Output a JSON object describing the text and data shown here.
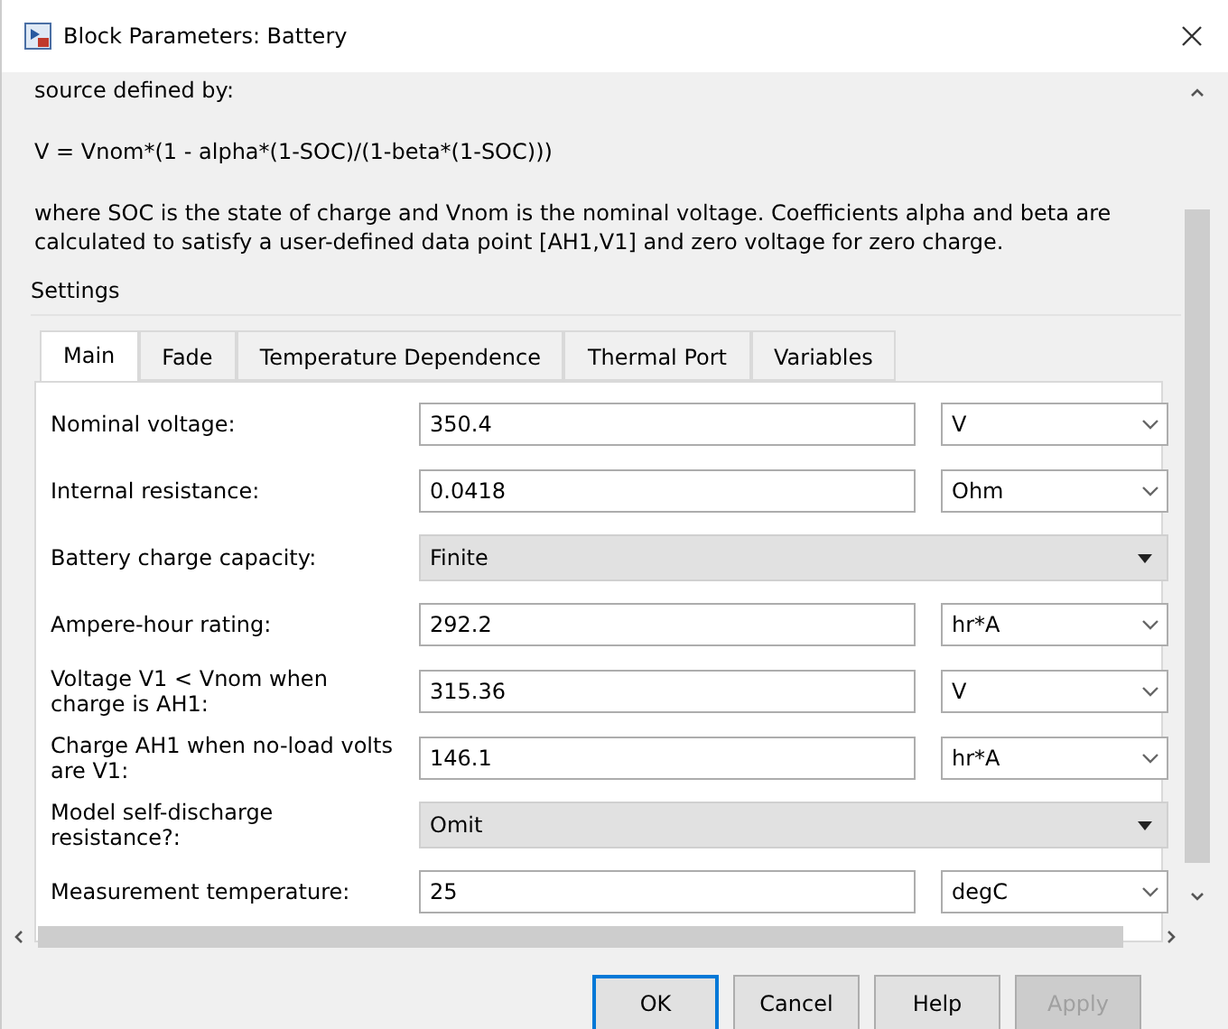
{
  "window": {
    "title": "Block Parameters: Battery"
  },
  "description": [
    "source defined by:",
    "V = Vnom*(1 - alpha*(1-SOC)/(1-beta*(1-SOC)))",
    "where SOC is the state of charge and Vnom is the nominal voltage. Coefficients alpha and beta are calculated to satisfy a user-defined data point [AH1,V1] and zero voltage for zero charge."
  ],
  "settings": {
    "title": "Settings",
    "tabs": [
      {
        "label": "Main",
        "selected": true
      },
      {
        "label": "Fade",
        "selected": false
      },
      {
        "label": "Temperature Dependence",
        "selected": false
      },
      {
        "label": "Thermal Port",
        "selected": false
      },
      {
        "label": "Variables",
        "selected": false
      }
    ],
    "rows": [
      {
        "kind": "value",
        "label": "Nominal voltage:",
        "value": "350.4",
        "unit": "V"
      },
      {
        "kind": "value",
        "label": "Internal resistance:",
        "value": "0.0418",
        "unit": "Ohm"
      },
      {
        "kind": "choice",
        "label": "Battery charge capacity:",
        "value": "Finite"
      },
      {
        "kind": "value",
        "label": "Ampere-hour rating:",
        "value": "292.2",
        "unit": "hr*A"
      },
      {
        "kind": "value",
        "label": "Voltage V1 < Vnom when charge is AH1:",
        "value": "315.36",
        "unit": "V"
      },
      {
        "kind": "value",
        "label": "Charge AH1 when no-load volts are V1:",
        "value": "146.1",
        "unit": "hr*A"
      },
      {
        "kind": "choice",
        "label": "Model self-discharge resistance?:",
        "value": "Omit"
      },
      {
        "kind": "value",
        "label": "Measurement temperature:",
        "value": "25",
        "unit": "degC"
      }
    ]
  },
  "buttons": [
    {
      "label": "OK",
      "focused": true,
      "disabled": false
    },
    {
      "label": "Cancel",
      "focused": false,
      "disabled": false
    },
    {
      "label": "Help",
      "focused": false,
      "disabled": false
    },
    {
      "label": "Apply",
      "focused": false,
      "disabled": true
    }
  ]
}
